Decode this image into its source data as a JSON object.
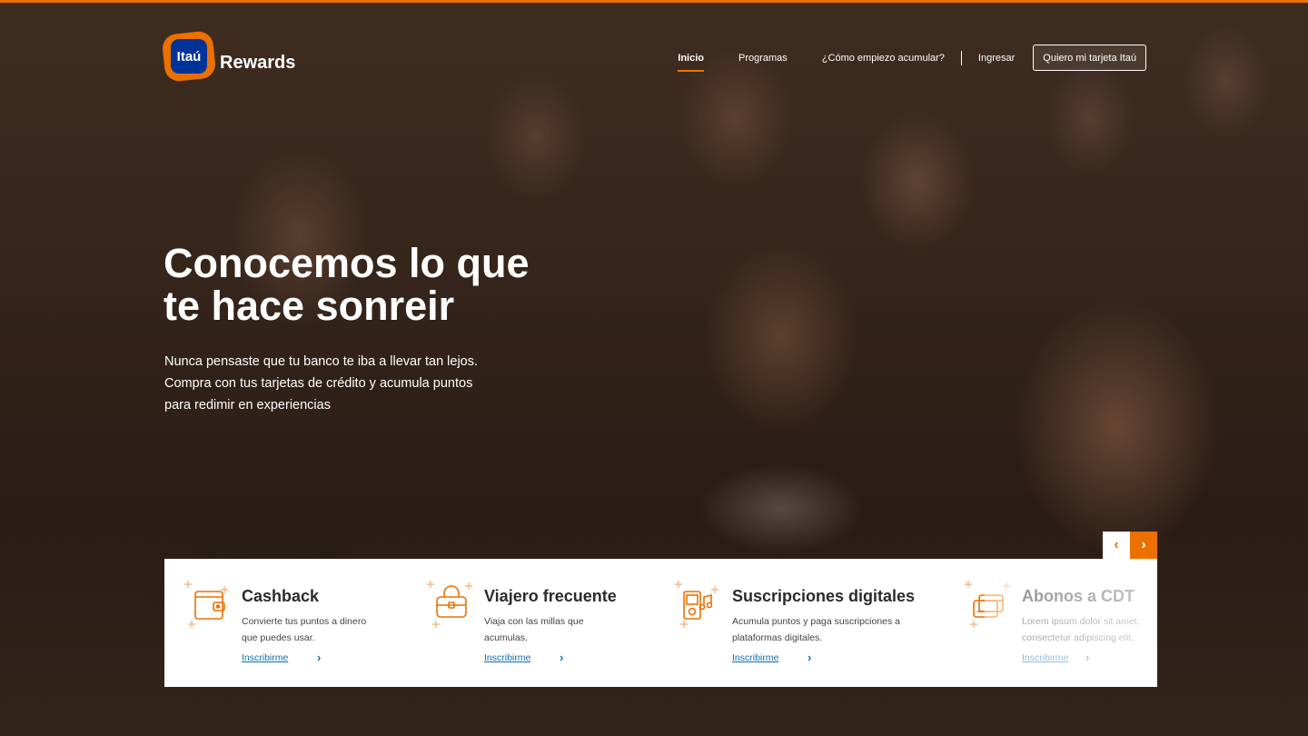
{
  "brand": {
    "logo_text": "Itaú",
    "product": "Rewards",
    "accent_color": "#ec7000",
    "logo_blue": "#003399"
  },
  "nav": {
    "items": [
      {
        "label": "Inicio",
        "active": true
      },
      {
        "label": "Programas",
        "active": false
      },
      {
        "label": "¿Cómo empiezo acumular?",
        "active": false
      }
    ],
    "login_label": "Ingresar",
    "cta_label": "Quiero mi tarjeta Itaú"
  },
  "hero": {
    "title_lines": [
      "Conocemos lo que",
      "te hace sonreir"
    ],
    "text_lines": [
      "Nunca pensaste que tu banco te iba a llevar tan lejos.",
      "Compra con tus tarjetas de crédito y acumula puntos",
      "para redimir en experiencias"
    ]
  },
  "carousel": {
    "prev_icon": "chevron-left-icon",
    "next_icon": "chevron-right-icon",
    "prev_glyph": "‹",
    "next_glyph": "›"
  },
  "cards": [
    {
      "icon": "wallet-icon",
      "title": "Cashback",
      "desc_lines": [
        "Convierte tus puntos a dinero",
        "que puedes usar."
      ],
      "link": "Inscribirme"
    },
    {
      "icon": "suitcase-icon",
      "title": "Viajero frecuente",
      "desc_lines": [
        "Viaja con las millas que",
        "acumulas."
      ],
      "link": "Inscribirme"
    },
    {
      "icon": "media-player-icon",
      "title": "Suscripciones digitales",
      "desc_lines": [
        "Acumula puntos y paga suscripciones a",
        "plataformas digitales."
      ],
      "link": "Inscribirme"
    },
    {
      "icon": "cards-icon",
      "title": "Abonos a CDT",
      "desc_lines": [
        "Lorem ipsum dolor sit amet,",
        "consectetur adipiscing elit."
      ],
      "link": "Inscribirme"
    }
  ]
}
